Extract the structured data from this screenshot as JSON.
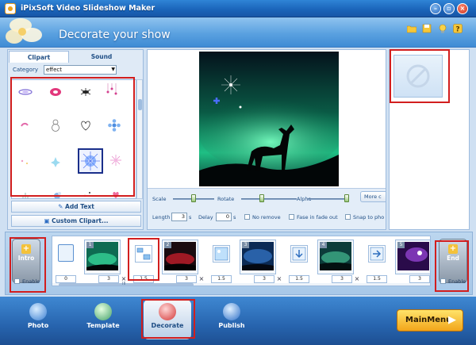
{
  "window": {
    "title": "iPixSoft Video Slideshow Maker"
  },
  "header": {
    "title": "Decorate your show"
  },
  "header_icons": [
    "folder-icon",
    "save-icon",
    "bulb-icon",
    "help-icon"
  ],
  "left_panel": {
    "tabs": [
      "Clipart",
      "Sound"
    ],
    "category_label": "Category",
    "category_value": "effect",
    "add_text": "Add Text",
    "custom_clipart": "Custom Clipart..."
  },
  "controls": {
    "scale": "Scale",
    "rotate": "Rotate",
    "alpha": "Alpha",
    "more": "More c",
    "length": "Length",
    "length_value": "3",
    "length_unit": "s",
    "delay": "Delay",
    "delay_value": "0",
    "delay_unit": "s",
    "no_remove": "No remove",
    "fade": "Fase in fade out",
    "snap": "Snap to pho"
  },
  "timeline": {
    "intro": "Intro",
    "end": "End",
    "enable": "Enable",
    "first_duration": "0",
    "frames": [
      {
        "num": "1",
        "duration": "3"
      },
      {
        "num": "2",
        "duration": "3"
      },
      {
        "num": "3",
        "duration": "3"
      },
      {
        "num": "4",
        "duration": "3"
      },
      {
        "num": "5",
        "duration": "3"
      }
    ],
    "transitions": [
      "1.5",
      "1.5",
      "1.5",
      "1.5",
      "1.5"
    ],
    "scroll_glyph": "III"
  },
  "nav": {
    "photo": "Photo",
    "template": "Template",
    "decorate": "Decorate",
    "publish": "Publish",
    "mainmenu": "MainMenu"
  },
  "colors": {
    "accent": "#2f84d6",
    "highlight": "#d21e1e",
    "mainmenu": "#f2a51a"
  }
}
